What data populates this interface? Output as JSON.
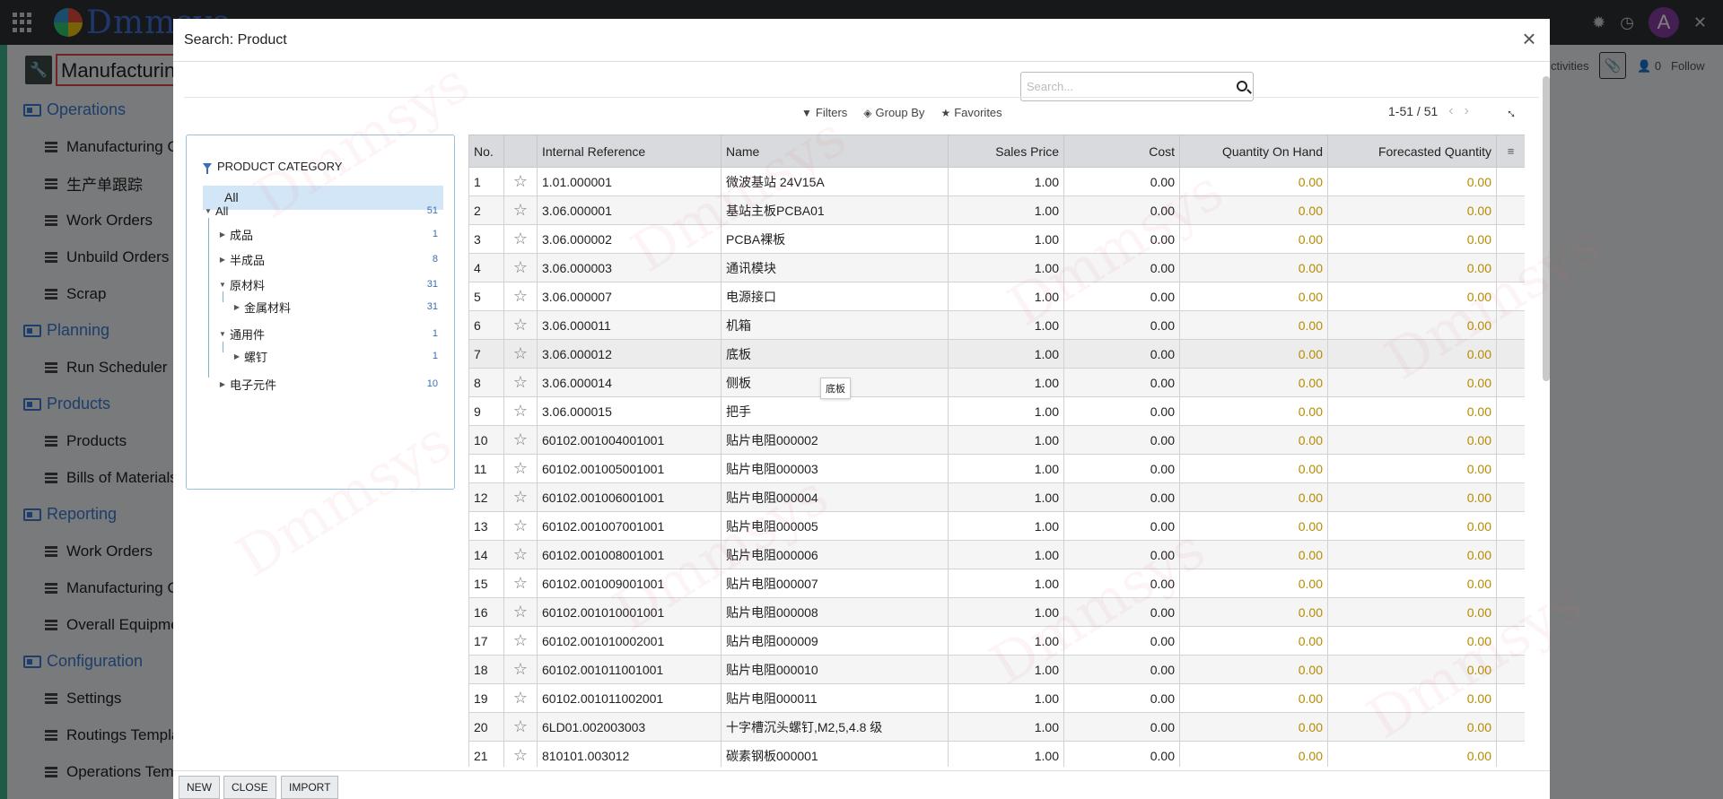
{
  "topbar": {
    "brand": "Dmmsys",
    "avatar_letter": "A"
  },
  "app": {
    "title": "Manufacturing"
  },
  "menu": [
    {
      "type": "section",
      "label": "Operations"
    },
    {
      "type": "item",
      "label": "Manufacturing Orders"
    },
    {
      "type": "item",
      "label": "生产单跟踪"
    },
    {
      "type": "item",
      "label": "Work Orders"
    },
    {
      "type": "item",
      "label": "Unbuild Orders"
    },
    {
      "type": "item",
      "label": "Scrap"
    },
    {
      "type": "section",
      "label": "Planning"
    },
    {
      "type": "item",
      "label": "Run Scheduler"
    },
    {
      "type": "section",
      "label": "Products"
    },
    {
      "type": "item",
      "label": "Products"
    },
    {
      "type": "item",
      "label": "Bills of Materials"
    },
    {
      "type": "section",
      "label": "Reporting"
    },
    {
      "type": "item",
      "label": "Work Orders"
    },
    {
      "type": "item",
      "label": "Manufacturing Orders"
    },
    {
      "type": "item",
      "label": "Overall Equipment Effectiveness"
    },
    {
      "type": "section",
      "label": "Configuration"
    },
    {
      "type": "item",
      "label": "Settings"
    },
    {
      "type": "item",
      "label": "Routings Templates"
    },
    {
      "type": "item",
      "label": "Operations Templates"
    }
  ],
  "background_right": {
    "activities": "ctivities",
    "count": "0",
    "follow": "Follow"
  },
  "modal": {
    "title": "Search: Product",
    "search_placeholder": "Search...",
    "filters": "Filters",
    "group_by": "Group By",
    "favorites": "Favorites",
    "pager": "1-51 / 51",
    "tooltip": "底板",
    "buttons": {
      "new": "NEW",
      "close": "CLOSE",
      "import": "IMPORT"
    }
  },
  "category_panel": {
    "header": "PRODUCT CATEGORY",
    "all_selected": "All",
    "nodes": [
      {
        "label": "All",
        "count": "51",
        "level": 0,
        "expanded": true
      },
      {
        "label": "成品",
        "count": "1",
        "level": 1,
        "expanded": false
      },
      {
        "label": "半成品",
        "count": "8",
        "level": 1,
        "expanded": false
      },
      {
        "label": "原材料",
        "count": "31",
        "level": 1,
        "expanded": true
      },
      {
        "label": "金属材料",
        "count": "31",
        "level": 2,
        "expanded": false
      },
      {
        "label": "通用件",
        "count": "1",
        "level": 1,
        "expanded": true
      },
      {
        "label": "螺钉",
        "count": "1",
        "level": 2,
        "expanded": false
      },
      {
        "label": "电子元件",
        "count": "10",
        "level": 1,
        "expanded": false
      }
    ]
  },
  "table": {
    "columns": [
      "No.",
      "",
      "Internal Reference",
      "Name",
      "Sales Price",
      "Cost",
      "Quantity On Hand",
      "Forecasted Quantity"
    ],
    "rows": [
      [
        "1",
        "1.01.000001",
        "微波基站 24V15A",
        "1.00",
        "0.00",
        "0.00",
        "0.00"
      ],
      [
        "2",
        "3.06.000001",
        "基站主板PCBA01",
        "1.00",
        "0.00",
        "0.00",
        "0.00"
      ],
      [
        "3",
        "3.06.000002",
        "PCBA裸板",
        "1.00",
        "0.00",
        "0.00",
        "0.00"
      ],
      [
        "4",
        "3.06.000003",
        "通讯模块",
        "1.00",
        "0.00",
        "0.00",
        "0.00"
      ],
      [
        "5",
        "3.06.000007",
        "电源接口",
        "1.00",
        "0.00",
        "0.00",
        "0.00"
      ],
      [
        "6",
        "3.06.000011",
        "机箱",
        "1.00",
        "0.00",
        "0.00",
        "0.00"
      ],
      [
        "7",
        "3.06.000012",
        "底板",
        "1.00",
        "0.00",
        "0.00",
        "0.00"
      ],
      [
        "8",
        "3.06.000014",
        "侧板",
        "1.00",
        "0.00",
        "0.00",
        "0.00"
      ],
      [
        "9",
        "3.06.000015",
        "把手",
        "1.00",
        "0.00",
        "0.00",
        "0.00"
      ],
      [
        "10",
        "60102.001004001001",
        "贴片电阻000002",
        "1.00",
        "0.00",
        "0.00",
        "0.00"
      ],
      [
        "11",
        "60102.001005001001",
        "贴片电阻000003",
        "1.00",
        "0.00",
        "0.00",
        "0.00"
      ],
      [
        "12",
        "60102.001006001001",
        "贴片电阻000004",
        "1.00",
        "0.00",
        "0.00",
        "0.00"
      ],
      [
        "13",
        "60102.001007001001",
        "贴片电阻000005",
        "1.00",
        "0.00",
        "0.00",
        "0.00"
      ],
      [
        "14",
        "60102.001008001001",
        "贴片电阻000006",
        "1.00",
        "0.00",
        "0.00",
        "0.00"
      ],
      [
        "15",
        "60102.001009001001",
        "贴片电阻000007",
        "1.00",
        "0.00",
        "0.00",
        "0.00"
      ],
      [
        "16",
        "60102.001010001001",
        "贴片电阻000008",
        "1.00",
        "0.00",
        "0.00",
        "0.00"
      ],
      [
        "17",
        "60102.001010002001",
        "贴片电阻000009",
        "1.00",
        "0.00",
        "0.00",
        "0.00"
      ],
      [
        "18",
        "60102.001011001001",
        "贴片电阻000010",
        "1.00",
        "0.00",
        "0.00",
        "0.00"
      ],
      [
        "19",
        "60102.001011002001",
        "贴片电阻000011",
        "1.00",
        "0.00",
        "0.00",
        "0.00"
      ],
      [
        "20",
        "6LD01.002003003",
        "十字槽沉头螺钉,M2,5,4.8 级",
        "1.00",
        "0.00",
        "0.00",
        "0.00"
      ],
      [
        "21",
        "810101.003012",
        "碳素钢板000001",
        "1.00",
        "0.00",
        "0.00",
        "0.00"
      ]
    ]
  }
}
